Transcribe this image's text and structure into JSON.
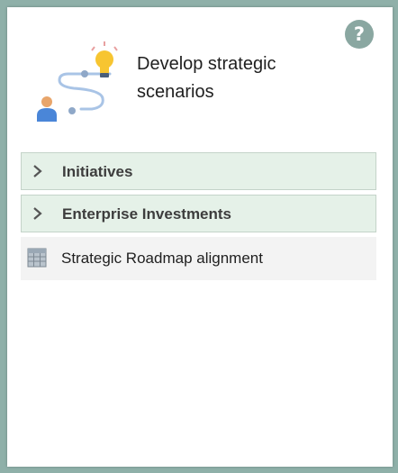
{
  "card": {
    "title": "Develop strategic scenarios",
    "help_label": "?",
    "illustration_icon": "strategy-path-illustration"
  },
  "sections": [
    {
      "label": "Initiatives",
      "icon": "chevron-right-icon",
      "expanded": false
    },
    {
      "label": "Enterprise Investments",
      "icon": "chevron-right-icon",
      "expanded": false
    }
  ],
  "links": [
    {
      "label": "Strategic Roadmap alignment",
      "icon": "grid-report-icon"
    }
  ],
  "colors": {
    "background": "#8fb0a9",
    "section_row_bg": "#e5f1e8",
    "link_row_bg": "#f3f3f3",
    "help_button": "#8aa7a1",
    "bulb": "#f7c531",
    "person_body": "#4a86d8",
    "person_head": "#e8a56b",
    "path": "#a9c4e6"
  }
}
